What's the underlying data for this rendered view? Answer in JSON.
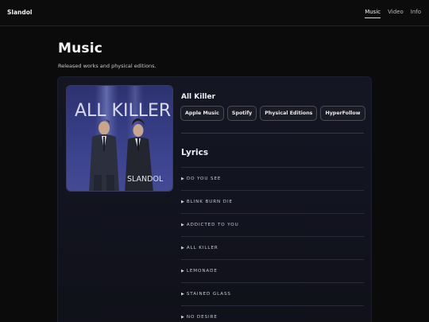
{
  "brand": "Slandol",
  "nav": [
    {
      "label": "Music",
      "active": true
    },
    {
      "label": "Video",
      "active": false
    },
    {
      "label": "Info",
      "active": false
    }
  ],
  "page": {
    "title": "Music",
    "subtitle": "Released works and physical editions."
  },
  "album": {
    "title": "All Killer",
    "cover_text": {
      "top": "ALL KILLER",
      "bottom": "SLANDOL"
    },
    "links": [
      "Apple Music",
      "Spotify",
      "Physical Editions",
      "HyperFollow"
    ]
  },
  "lyrics": {
    "heading": "Lyrics",
    "items": [
      "DO YOU SEE",
      "BLINK BURN DIE",
      "ADDICTED TO YOU",
      "ALL KILLER",
      "LEMONADE",
      "STAINED GLASS",
      "NO DESIRE"
    ]
  },
  "colors": {
    "background": "#0b0b0c",
    "card": "#131522",
    "cover_blue": "#3f4690"
  }
}
